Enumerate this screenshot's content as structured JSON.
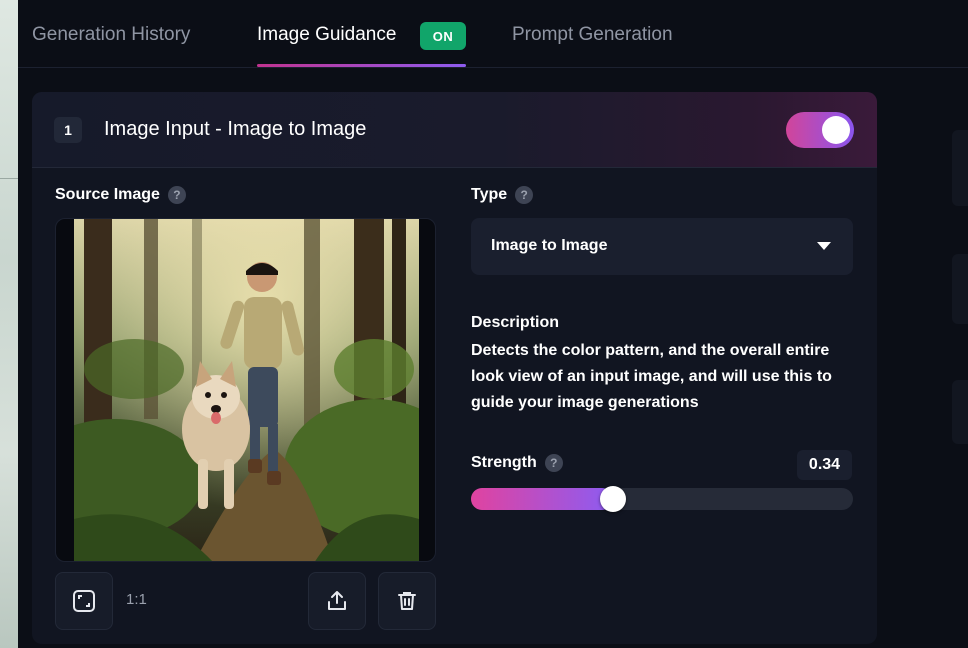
{
  "tabs": [
    {
      "label": "Generation History",
      "active": false
    },
    {
      "label": "Image Guidance",
      "active": true,
      "badge": "ON"
    },
    {
      "label": "Prompt Generation",
      "active": false
    }
  ],
  "card": {
    "step": "1",
    "title": "Image Input - Image to Image",
    "enabled": true,
    "source_label": "Source Image",
    "help_glyph": "?",
    "aspect_ratio": "1:1",
    "type_label": "Type",
    "type_value": "Image to Image",
    "description_title": "Description",
    "description_text": "Detects the color pattern, and the overall entire look view of an input image, and will use this to guide your image generations",
    "strength_label": "Strength",
    "strength_value": "0.34",
    "strength": 0.34
  },
  "colors": {
    "accent_start": "#e043a0",
    "accent_end": "#8c5cf2",
    "badge_on": "#11a56a",
    "background": "#0b0e16",
    "card": "#111521"
  },
  "icons": [
    "crop-icon",
    "upload-icon",
    "trash-icon",
    "help-icon",
    "caret-down-icon"
  ]
}
